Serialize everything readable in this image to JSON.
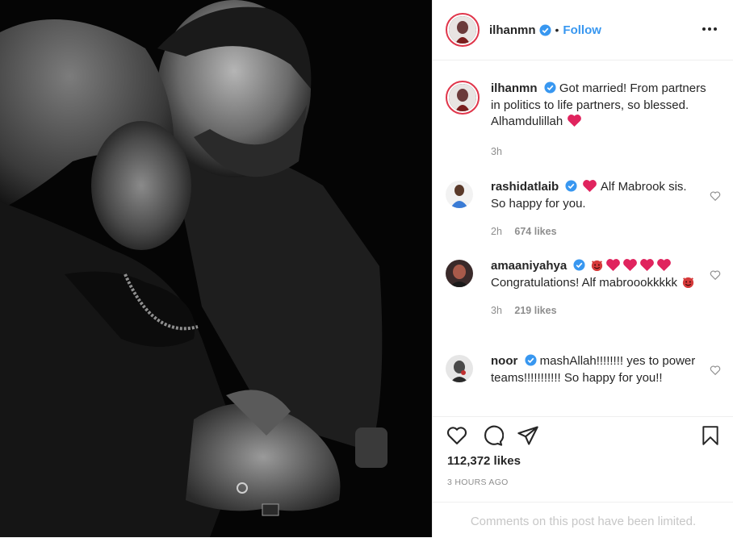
{
  "post": {
    "author": "ilhanmn",
    "follow_label": "Follow",
    "separator": "•",
    "caption": {
      "username": "ilhanmn",
      "text": "Got married! From partners in politics to life partners, so blessed. Alhamdulillah",
      "time": "3h"
    },
    "comments": [
      {
        "username": "rashidatlaib",
        "text_after_heart": "Alf Mabrook sis. So happy for you.",
        "time": "2h",
        "likes": "674 likes"
      },
      {
        "username": "amaaniyahya",
        "text": "Congratulations! Alf mabroookkkkk",
        "time": "3h",
        "likes": "219 likes"
      },
      {
        "username": "noor",
        "text": "mashAllah!!!!!!!! yes to power teams!!!!!!!!!!! So happy for you!!"
      }
    ],
    "likes_count": "112,372 likes",
    "posted_ago": "3 HOURS AGO",
    "comments_limited": "Comments on this post have been limited."
  },
  "icons": {
    "verified": "verified-badge-icon",
    "heart": "heart-icon",
    "comment": "comment-icon",
    "share": "share-icon",
    "bookmark": "bookmark-icon",
    "more": "more-options-icon"
  },
  "colors": {
    "follow": "#3897f0",
    "verified": "#3897f0",
    "heart_emoji": "#e0245e",
    "muted": "#8e8e8e"
  }
}
